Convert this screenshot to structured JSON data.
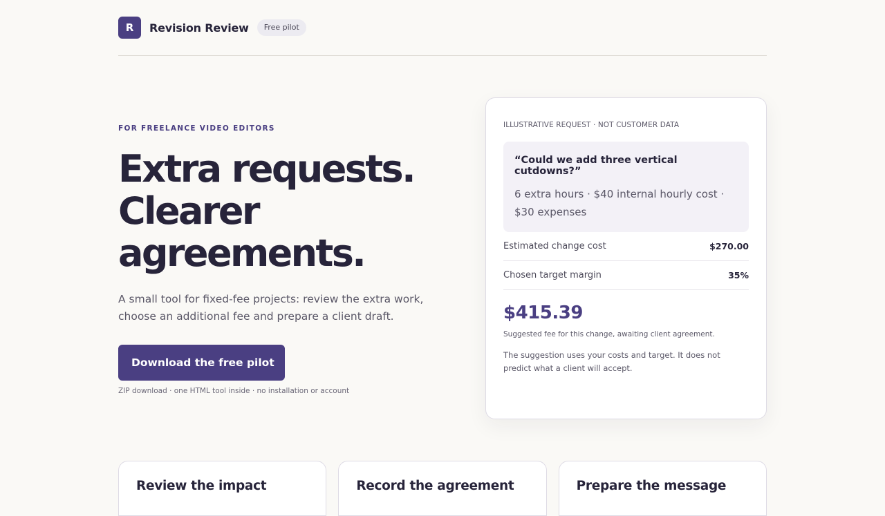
{
  "header": {
    "logo_letter": "R",
    "brand": "Revision Review",
    "badge": "Free pilot"
  },
  "hero": {
    "eyebrow": "FOR FREELANCE VIDEO EDITORS",
    "headline_lines": [
      "Extra requests.",
      "Clearer",
      "agreements."
    ],
    "subtitle": "A small tool for fixed-fee projects: review the extra work, choose an additional fee and prepare a client draft.",
    "cta_label": "Download the free pilot",
    "cta_note": "ZIP download · one HTML tool inside · no installation or account"
  },
  "example_card": {
    "label": "ILLUSTRATIVE REQUEST · NOT CUSTOMER DATA",
    "request_quote": "“Could we add three vertical cutdowns?”",
    "request_detail": "6 extra hours · $40 internal hourly cost · $30 expenses",
    "rows": [
      {
        "label": "Estimated change cost",
        "value": "$270.00"
      },
      {
        "label": "Chosen target margin",
        "value": "35%"
      }
    ],
    "suggested_fee": "$415.39",
    "fee_caption": "Suggested fee for this change, awaiting client agreement.",
    "disclaimer": "The suggestion uses your costs and target. It does not predict what a client will accept."
  },
  "features": [
    {
      "title": "Review the impact"
    },
    {
      "title": "Record the agreement"
    },
    {
      "title": "Prepare the message"
    }
  ],
  "colors": {
    "accent": "#4a3f82",
    "background": "#faf9f6",
    "text": "#27243a"
  }
}
